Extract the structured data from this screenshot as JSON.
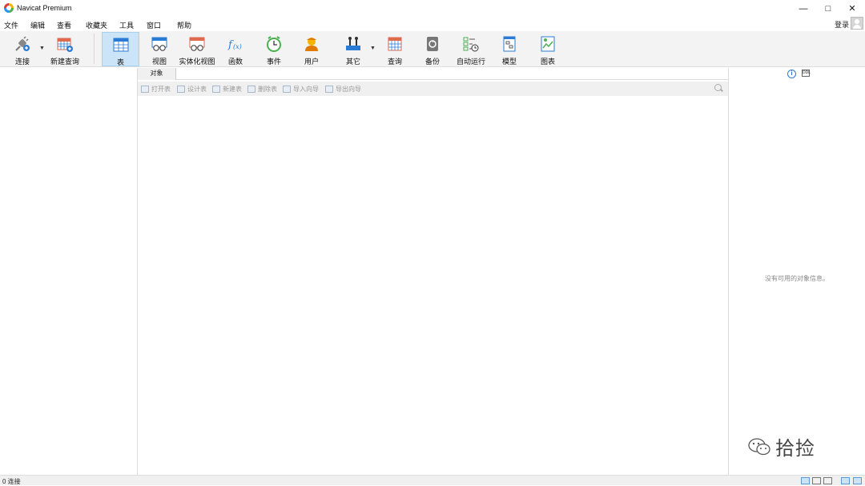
{
  "window": {
    "title": "Navicat Premium"
  },
  "menu": [
    "文件",
    "编辑",
    "查看",
    "收藏夹",
    "工具",
    "窗口",
    "帮助"
  ],
  "account": {
    "login_label": "登录"
  },
  "toolbar": {
    "connect": "连接",
    "new_query": "新建查询",
    "table": "表",
    "view": "视图",
    "materialized_view": "实体化视图",
    "function": "函数",
    "event": "事件",
    "user": "用户",
    "other": "其它",
    "query": "查询",
    "backup": "备份",
    "automation": "自动运行",
    "model": "模型",
    "chart": "图表",
    "active": "表"
  },
  "object_tab": {
    "label": "对象"
  },
  "object_toolbar": {
    "open_table": "打开表",
    "design_table": "设计表",
    "new_table": "新建表",
    "delete_table": "删除表",
    "import_wizard": "导入向导",
    "export_wizard": "导出向导"
  },
  "info_panel": {
    "empty_message": "没有可用的对象信息。"
  },
  "watermark": {
    "text": "拾捡"
  },
  "status": {
    "connections": "0 连接"
  },
  "colors": {
    "accent": "#2a7bd6",
    "active_tool_bg": "#cce4f7",
    "toolbar_bg": "#f3f3f3"
  }
}
